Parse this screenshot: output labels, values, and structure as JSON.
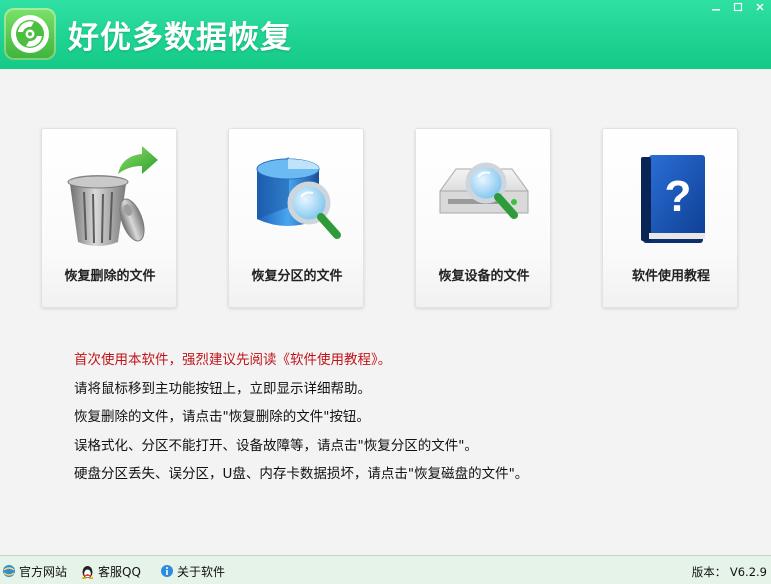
{
  "app": {
    "title": "好优多数据恢复"
  },
  "window_controls": {
    "minimize_icon": "minimize-icon",
    "maximize_icon": "maximize-icon",
    "close_icon": "close-icon"
  },
  "cards": [
    {
      "label": "恢复删除的文件",
      "icon": "recycle-bin-restore-icon"
    },
    {
      "label": "恢复分区的文件",
      "icon": "partition-search-icon"
    },
    {
      "label": "恢复设备的文件",
      "icon": "device-search-icon"
    },
    {
      "label": "软件使用教程",
      "icon": "help-book-icon"
    }
  ],
  "instructions": {
    "warning": "首次使用本软件，强烈建议先阅读《软件使用教程》。",
    "lines": [
      "请将鼠标移到主功能按钮上，立即显示详细帮助。",
      "恢复删除的文件，请点击\"恢复删除的文件\"按钮。",
      "误格式化、分区不能打开、设备故障等，请点击\"恢复分区的文件\"。",
      "硬盘分区丢失、误分区，U盘、内存卡数据损坏，请点击\"恢复磁盘的文件\"。"
    ]
  },
  "statusbar": {
    "links": [
      {
        "label": "官方网站",
        "icon": "browser-icon"
      },
      {
        "label": "客服QQ",
        "icon": "qq-penguin-icon"
      },
      {
        "label": "关于软件",
        "icon": "info-icon"
      }
    ],
    "version": "版本： V6.2.9"
  },
  "colors": {
    "titlebar": "#1fd392",
    "warning_text": "#c0141a",
    "statusbar": "#e5f3e9"
  }
}
